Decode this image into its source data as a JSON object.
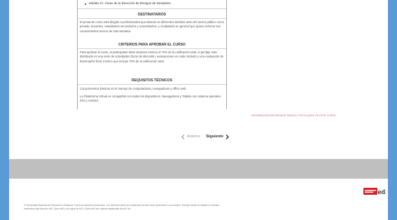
{
  "document": {
    "bullet_item": "Módulo IV: Áreas de la Dirección de Riesgos de Desastres",
    "sections": [
      {
        "title": "DESTINATARIOS",
        "text": "El presente curso está dirigido a profesionales que laboran en diferentes ámbitos tanto del sector público como privado, docentes, estudiantes secundarios y universitarios, y ciudadanía en general que quiera reforzar sus conocimientos acerca de esta temática."
      },
      {
        "title": "CRITERIOS PARA APROBAR EL CURSO",
        "text": "Para aprobar el curso, el participante debe alcanzar mínimo el 70% de la calificación total, el puntaje está distribuido en una serie de actividades (foros de discusión, evaluaciones en cada módulo) y una evaluación de desempeño final; mínimo que incluye 70% de la calificación total."
      },
      {
        "title": "REQUISITOS TÉCNICOS",
        "lines": [
          "Conocimientos básicos en el manejo de computadoras, navegadores y office web.",
          "La Plataforma Virtual es compatible con todos los dispositivos. Navegadores y Tablets con sistema operativo iOS y Android."
        ]
      }
    ]
  },
  "notice_link": "INFORMACIÓN IMPORTANTE PARA EL POSTULANTE DE ESTE CURSO",
  "pager": {
    "prev_label": "Anterior",
    "next_label": "Siguiente"
  },
  "footer": {
    "logo_text": "edX",
    "lines": [
      "© Universidad Nacional de Educación a Distancia. Todos los derechos reservados. Los derechos sobre los contenidos de este curso pertenecen a sus autores. Excepto donde se indique lo contrario,",
      "contenidos bajo licencia. edX, Open edX y los logos de edX y Open edX son marcas registradas de edX Inc."
    ]
  },
  "colors": {
    "outer_bg": "#5b9bd5",
    "accent_link": "#d25c7a",
    "logo_red": "#d8202a"
  }
}
